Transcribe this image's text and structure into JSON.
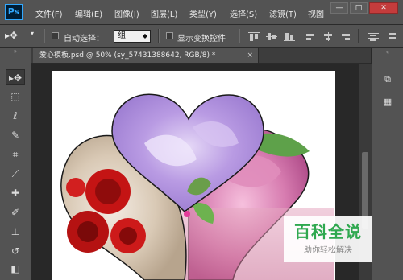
{
  "app": {
    "logo": "Ps"
  },
  "menu": [
    "文件(F)",
    "编辑(E)",
    "图像(I)",
    "图层(L)",
    "类型(Y)",
    "选择(S)",
    "滤镜(T)",
    "视图"
  ],
  "window_controls": {
    "minimize": "—",
    "restore": "□",
    "close": "✕"
  },
  "options_bar": {
    "move_tool_icon": "move-tool-icon",
    "auto_select_label": "自动选择：",
    "auto_select_checked": false,
    "auto_select_value": "组",
    "show_transform_label": "显示变换控件",
    "show_transform_checked": false
  },
  "document_tab": {
    "title": "爱心模板.psd @ 50% (sy_57431388642, RGB/8) *",
    "close": "×"
  },
  "tools": [
    "move-tool-icon",
    "marquee-tool-icon",
    "lasso-tool-icon",
    "quick-select-tool-icon",
    "crop-tool-icon",
    "eyedropper-tool-icon",
    "healing-brush-icon",
    "brush-tool-icon",
    "clone-stamp-icon",
    "history-brush-icon",
    "eraser-tool-icon"
  ],
  "panels": [
    "history-panel-icon",
    "properties-panel-icon"
  ],
  "watermark": {
    "title": "百科全说",
    "subtitle": "助你轻松解决"
  }
}
